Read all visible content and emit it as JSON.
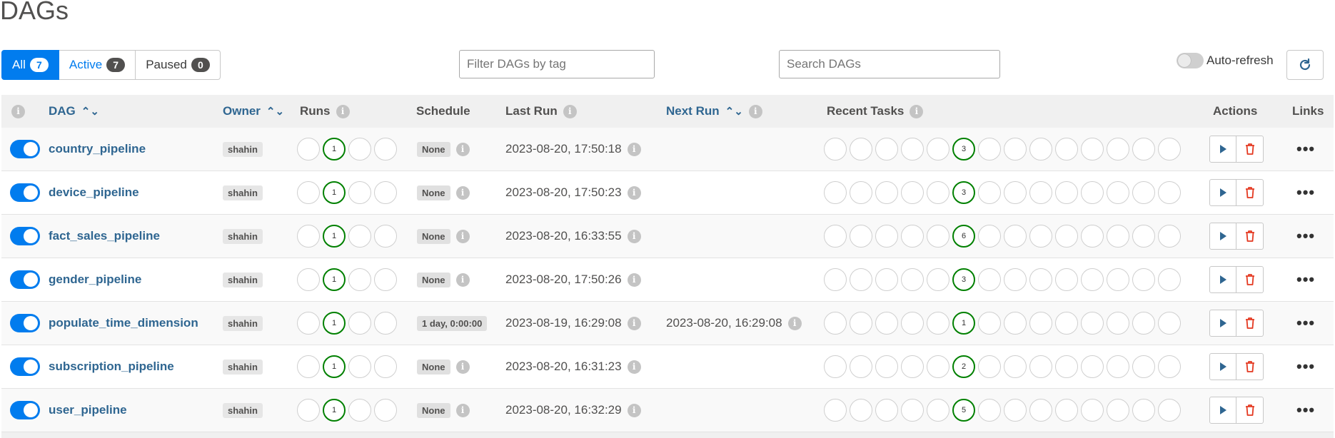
{
  "page_title": "DAGs",
  "filters": {
    "all": {
      "label": "All",
      "count": "7"
    },
    "active": {
      "label": "Active",
      "count": "7"
    },
    "paused": {
      "label": "Paused",
      "count": "0"
    }
  },
  "tag_filter": {
    "placeholder": "Filter DAGs by tag",
    "value": ""
  },
  "search": {
    "placeholder": "Search DAGs",
    "value": ""
  },
  "auto_refresh": {
    "label": "Auto-refresh",
    "enabled": false
  },
  "table": {
    "headers": {
      "dag": "DAG",
      "owner": "Owner",
      "runs": "Runs",
      "schedule": "Schedule",
      "last_run": "Last Run",
      "next_run": "Next Run",
      "recent_tasks": "Recent Tasks",
      "actions": "Actions",
      "links": "Links"
    },
    "rows": [
      {
        "name": "country_pipeline",
        "owner": "shahin",
        "runs_success": "1",
        "schedule": "None",
        "last_run": "2023-08-20, 17:50:18",
        "next_run": "",
        "tasks_success": "3",
        "links": "•••"
      },
      {
        "name": "device_pipeline",
        "owner": "shahin",
        "runs_success": "1",
        "schedule": "None",
        "last_run": "2023-08-20, 17:50:23",
        "next_run": "",
        "tasks_success": "3",
        "links": "•••"
      },
      {
        "name": "fact_sales_pipeline",
        "owner": "shahin",
        "runs_success": "1",
        "schedule": "None",
        "last_run": "2023-08-20, 16:33:55",
        "next_run": "",
        "tasks_success": "6",
        "links": "•••"
      },
      {
        "name": "gender_pipeline",
        "owner": "shahin",
        "runs_success": "1",
        "schedule": "None",
        "last_run": "2023-08-20, 17:50:26",
        "next_run": "",
        "tasks_success": "3",
        "links": "•••"
      },
      {
        "name": "populate_time_dimension",
        "owner": "shahin",
        "runs_success": "1",
        "schedule": "1 day, 0:00:00",
        "last_run": "2023-08-19, 16:29:08",
        "next_run": "2023-08-20, 16:29:08",
        "tasks_success": "1",
        "links": "•••"
      },
      {
        "name": "subscription_pipeline",
        "owner": "shahin",
        "runs_success": "1",
        "schedule": "None",
        "last_run": "2023-08-20, 16:31:23",
        "next_run": "",
        "tasks_success": "2",
        "links": "•••"
      },
      {
        "name": "user_pipeline",
        "owner": "shahin",
        "runs_success": "1",
        "schedule": "None",
        "last_run": "2023-08-20, 16:32:29",
        "next_run": "",
        "tasks_success": "5",
        "links": "•••"
      }
    ]
  },
  "colors": {
    "primary": "#017cee",
    "link": "#2f6691",
    "success": "#008000",
    "delete": "#e43921"
  },
  "icons": {
    "info": "info-icon",
    "sort": "sort-icon",
    "refresh": "refresh-icon",
    "trigger": "play-icon",
    "delete": "trash-icon"
  }
}
